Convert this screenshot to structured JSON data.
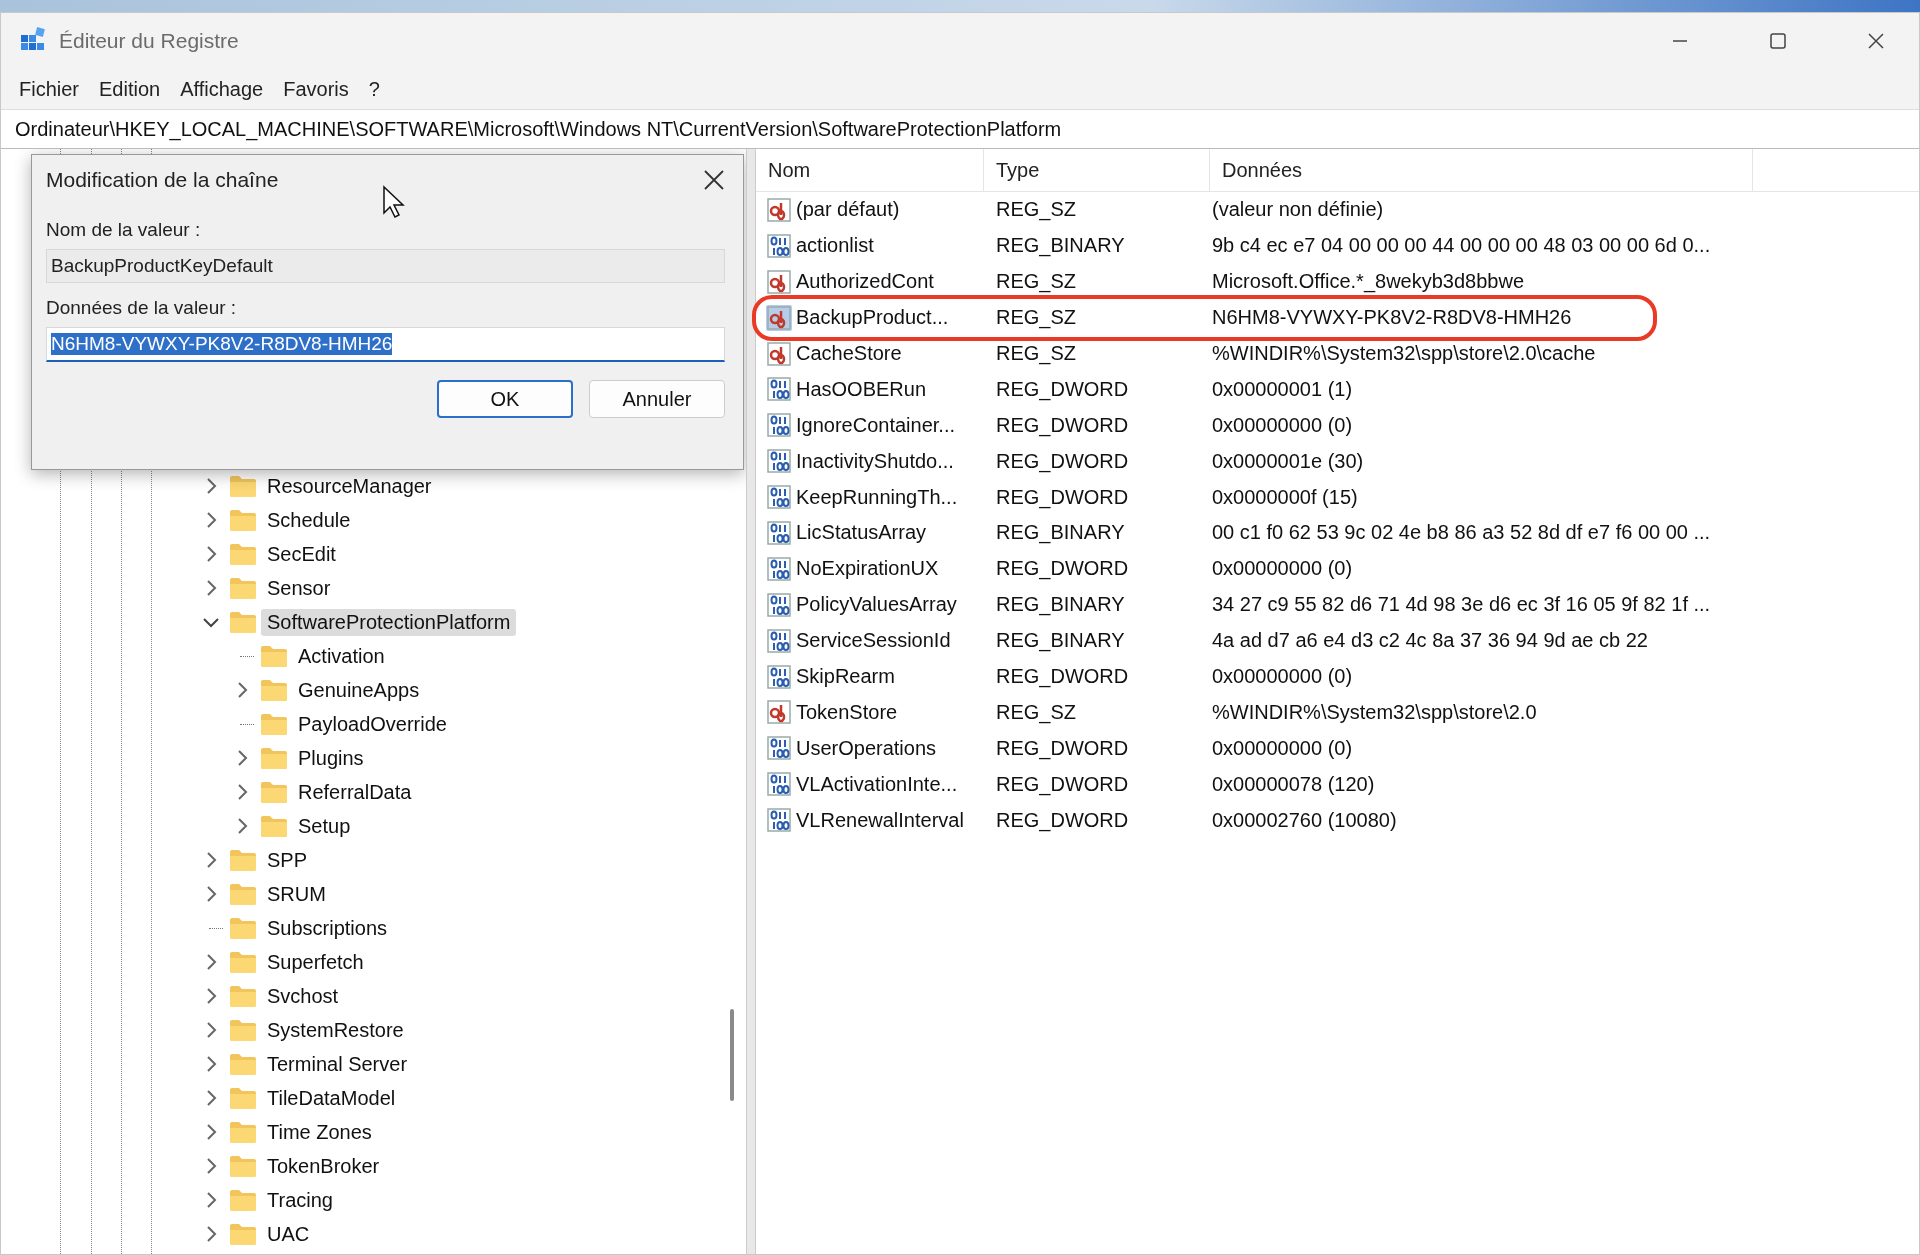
{
  "window": {
    "title": "Éditeur du Registre"
  },
  "menu": [
    "Fichier",
    "Edition",
    "Affichage",
    "Favoris",
    "?"
  ],
  "address": "Ordinateur\\HKEY_LOCAL_MACHINE\\SOFTWARE\\Microsoft\\Windows NT\\CurrentVersion\\SoftwareProtectionPlatform",
  "tree": [
    {
      "name": "ResourceManager",
      "expandable": true,
      "expanded": false,
      "selected": false
    },
    {
      "name": "Schedule",
      "expandable": true,
      "expanded": false,
      "selected": false
    },
    {
      "name": "SecEdit",
      "expandable": true,
      "expanded": false,
      "selected": false
    },
    {
      "name": "Sensor",
      "expandable": true,
      "expanded": false,
      "selected": false
    },
    {
      "name": "SoftwareProtectionPlatform",
      "expandable": true,
      "expanded": true,
      "selected": true,
      "children": [
        {
          "name": "Activation",
          "expandable": false,
          "selected": false
        },
        {
          "name": "GenuineApps",
          "expandable": true,
          "expanded": false,
          "selected": false
        },
        {
          "name": "PayloadOverride",
          "expandable": false,
          "selected": false
        },
        {
          "name": "Plugins",
          "expandable": true,
          "expanded": false,
          "selected": false
        },
        {
          "name": "ReferralData",
          "expandable": true,
          "expanded": false,
          "selected": false
        },
        {
          "name": "Setup",
          "expandable": true,
          "expanded": false,
          "selected": false
        }
      ]
    },
    {
      "name": "SPP",
      "expandable": true,
      "expanded": false,
      "selected": false
    },
    {
      "name": "SRUM",
      "expandable": true,
      "expanded": false,
      "selected": false
    },
    {
      "name": "Subscriptions",
      "expandable": false,
      "selected": false
    },
    {
      "name": "Superfetch",
      "expandable": true,
      "expanded": false,
      "selected": false
    },
    {
      "name": "Svchost",
      "expandable": true,
      "expanded": false,
      "selected": false
    },
    {
      "name": "SystemRestore",
      "expandable": true,
      "expanded": false,
      "selected": false
    },
    {
      "name": "Terminal Server",
      "expandable": true,
      "expanded": false,
      "selected": false
    },
    {
      "name": "TileDataModel",
      "expandable": true,
      "expanded": false,
      "selected": false
    },
    {
      "name": "Time Zones",
      "expandable": true,
      "expanded": false,
      "selected": false
    },
    {
      "name": "TokenBroker",
      "expandable": true,
      "expanded": false,
      "selected": false
    },
    {
      "name": "Tracing",
      "expandable": true,
      "expanded": false,
      "selected": false
    },
    {
      "name": "UAC",
      "expandable": true,
      "expanded": false,
      "selected": false
    }
  ],
  "columns": [
    "Nom",
    "Type",
    "Données"
  ],
  "values": [
    {
      "name": "(par défaut)",
      "kind": "string",
      "type": "REG_SZ",
      "data": "(valeur non définie)",
      "selected": false,
      "highlighted": false
    },
    {
      "name": "actionlist",
      "kind": "binary",
      "type": "REG_BINARY",
      "data": "9b c4 ec e7 04 00 00 00 44 00 00 00 48 03 00 00 6d 0...",
      "selected": false,
      "highlighted": false
    },
    {
      "name": "AuthorizedCont",
      "kind": "string",
      "type": "REG_SZ",
      "data": "Microsoft.Office.*_8wekyb3d8bbwe",
      "selected": false,
      "highlighted": false
    },
    {
      "name": "BackupProduct...",
      "kind": "string",
      "type": "REG_SZ",
      "data": "N6HM8-VYWXY-PK8V2-R8DV8-HMH26",
      "selected": true,
      "highlighted": true
    },
    {
      "name": "CacheStore",
      "kind": "string",
      "type": "REG_SZ",
      "data": "%WINDIR%\\System32\\spp\\store\\2.0\\cache",
      "selected": false,
      "highlighted": false
    },
    {
      "name": "HasOOBERun",
      "kind": "binary",
      "type": "REG_DWORD",
      "data": "0x00000001 (1)",
      "selected": false,
      "highlighted": false
    },
    {
      "name": "IgnoreContainer...",
      "kind": "binary",
      "type": "REG_DWORD",
      "data": "0x00000000 (0)",
      "selected": false,
      "highlighted": false
    },
    {
      "name": "InactivityShutdo...",
      "kind": "binary",
      "type": "REG_DWORD",
      "data": "0x0000001e (30)",
      "selected": false,
      "highlighted": false
    },
    {
      "name": "KeepRunningTh...",
      "kind": "binary",
      "type": "REG_DWORD",
      "data": "0x0000000f (15)",
      "selected": false,
      "highlighted": false
    },
    {
      "name": "LicStatusArray",
      "kind": "binary",
      "type": "REG_BINARY",
      "data": "00 c1 f0 62 53 9c 02 4e b8 86 a3 52 8d df e7 f6 00 00 ...",
      "selected": false,
      "highlighted": false
    },
    {
      "name": "NoExpirationUX",
      "kind": "binary",
      "type": "REG_DWORD",
      "data": "0x00000000 (0)",
      "selected": false,
      "highlighted": false
    },
    {
      "name": "PolicyValuesArray",
      "kind": "binary",
      "type": "REG_BINARY",
      "data": "34 27 c9 55 82 d6 71 4d 98 3e d6 ec 3f 16 05 9f 82 1f ...",
      "selected": false,
      "highlighted": false
    },
    {
      "name": "ServiceSessionId",
      "kind": "binary",
      "type": "REG_BINARY",
      "data": "4a ad d7 a6 e4 d3 c2 4c 8a 37 36 94 9d ae cb 22",
      "selected": false,
      "highlighted": false
    },
    {
      "name": "SkipRearm",
      "kind": "binary",
      "type": "REG_DWORD",
      "data": "0x00000000 (0)",
      "selected": false,
      "highlighted": false
    },
    {
      "name": "TokenStore",
      "kind": "string",
      "type": "REG_SZ",
      "data": "%WINDIR%\\System32\\spp\\store\\2.0",
      "selected": false,
      "highlighted": false
    },
    {
      "name": "UserOperations",
      "kind": "binary",
      "type": "REG_DWORD",
      "data": "0x00000000 (0)",
      "selected": false,
      "highlighted": false
    },
    {
      "name": "VLActivationInte...",
      "kind": "binary",
      "type": "REG_DWORD",
      "data": "0x00000078 (120)",
      "selected": false,
      "highlighted": false
    },
    {
      "name": "VLRenewalInterval",
      "kind": "binary",
      "type": "REG_DWORD",
      "data": "0x00002760 (10080)",
      "selected": false,
      "highlighted": false
    }
  ],
  "dialog": {
    "title": "Modification de la chaîne",
    "name_label": "Nom de la valeur :",
    "name_value": "BackupProductKeyDefault",
    "data_label": "Données de la valeur :",
    "data_value": "N6HM8-VYWXY-PK8V2-R8DV8-HMH26",
    "data_text_selected": true,
    "buttons": [
      {
        "label": "OK",
        "default": true
      },
      {
        "label": "Annuler",
        "default": false
      }
    ]
  }
}
